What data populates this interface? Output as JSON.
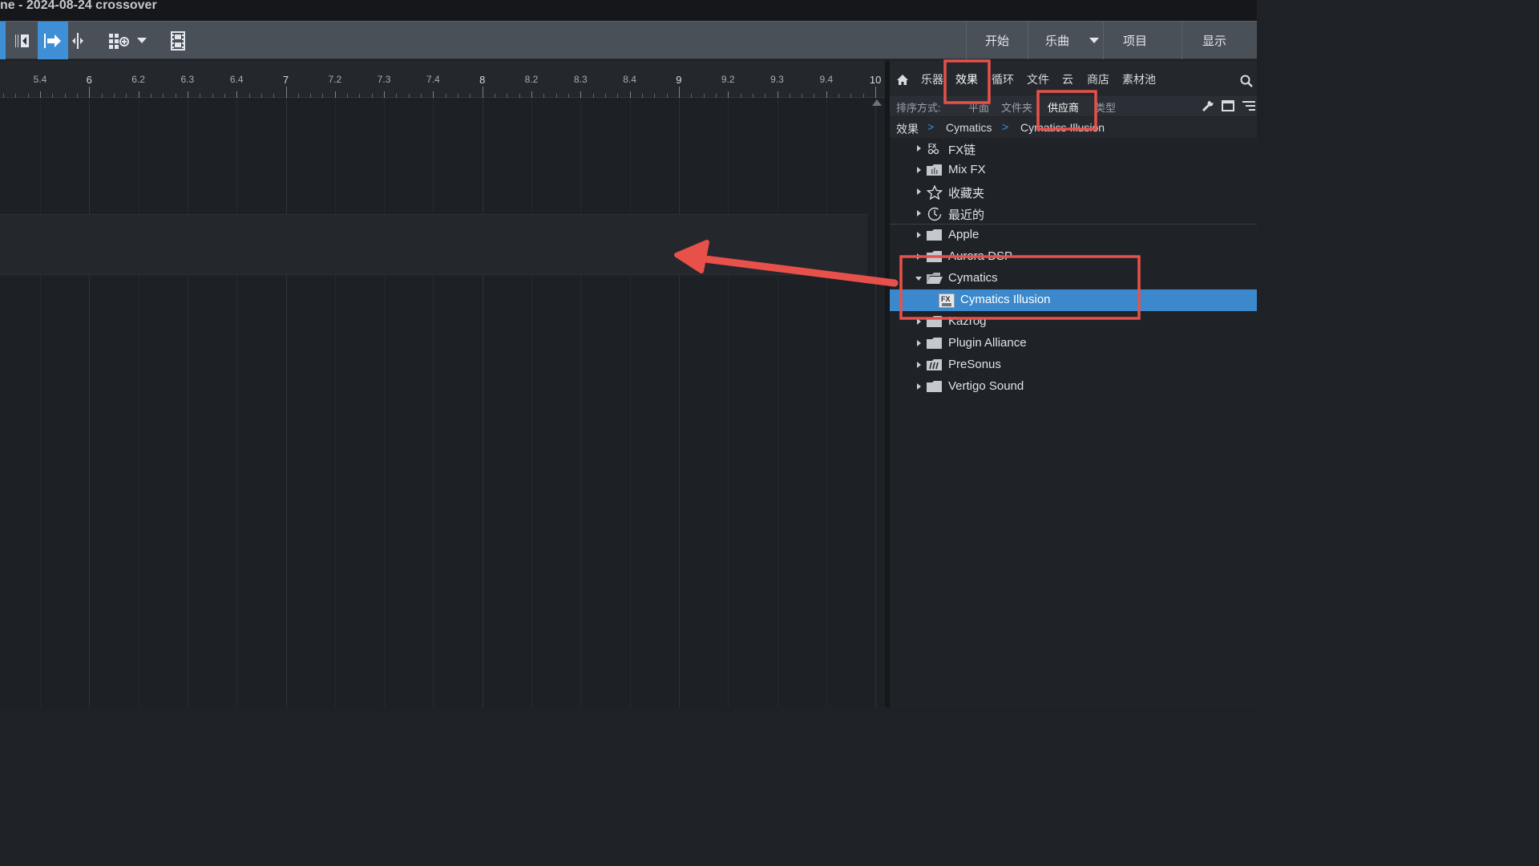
{
  "window": {
    "title": "ne - 2024-08-24 crossover"
  },
  "toolbar": {
    "tools": [
      {
        "name": "split-tool-icon"
      },
      {
        "name": "arrow-right-tool-icon"
      },
      {
        "name": "split-cursor-tool-icon"
      },
      {
        "name": "grid-add-tool-icon"
      },
      {
        "name": "film-strip-icon"
      }
    ],
    "nav": {
      "start": "开始",
      "song": "乐曲",
      "project": "项目",
      "show": "显示"
    }
  },
  "ruler": {
    "labels": [
      "5.4",
      "6",
      "6.2",
      "6.3",
      "6.4",
      "7",
      "7.2",
      "7.3",
      "7.4",
      "8",
      "8.2",
      "8.3",
      "8.4",
      "9",
      "9.2",
      "9.3",
      "9.4",
      "10"
    ]
  },
  "browser": {
    "tabs": {
      "instruments": "乐器",
      "effects": "效果",
      "loops": "循环",
      "files": "文件",
      "cloud": "云",
      "store": "商店",
      "pool": "素材池"
    },
    "sort": {
      "label": "排序方式:",
      "flat": "平面",
      "folder": "文件夹",
      "vendor": "供应商",
      "type": "类型"
    },
    "breadcrumb": [
      "效果",
      "Cymatics",
      "Cymatics Illusion"
    ],
    "tree": [
      {
        "label": "FX链",
        "icon": "fx-chain-icon"
      },
      {
        "label": "Mix FX",
        "icon": "mix-fx-icon"
      },
      {
        "label": "收藏夹",
        "icon": "star-icon"
      },
      {
        "label": "最近的",
        "icon": "clock-icon"
      },
      {
        "label": "Apple",
        "icon": "folder-icon"
      },
      {
        "label": "Aurora DSP",
        "icon": "folder-icon"
      },
      {
        "label": "Cymatics",
        "icon": "folder-open-icon",
        "expanded": true
      },
      {
        "label": "Cymatics Illusion",
        "icon": "fx-plugin-icon",
        "selected": true
      },
      {
        "label": "Kazrog",
        "icon": "folder-icon"
      },
      {
        "label": "Plugin Alliance",
        "icon": "folder-icon"
      },
      {
        "label": "PreSonus",
        "icon": "presonus-icon"
      },
      {
        "label": "Vertigo Sound",
        "icon": "folder-icon"
      }
    ]
  },
  "colors": {
    "accent": "#3f8fd6",
    "selection": "#3b88cc",
    "annotation": "#e8514a"
  }
}
